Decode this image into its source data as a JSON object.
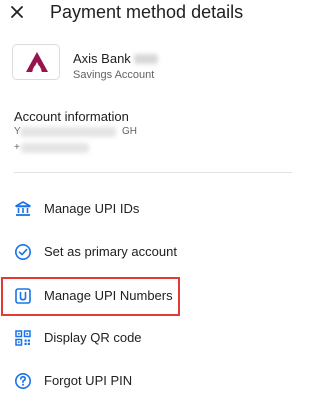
{
  "header": {
    "title": "Payment method details",
    "close_icon": "close-icon"
  },
  "bank": {
    "name": "Axis Bank",
    "name_masked_suffix": "(blurred)",
    "account_type": "Savings Account",
    "brand_color": "#97144d",
    "logo_icon": "axis-bank-logo"
  },
  "account_info": {
    "heading": "Account information",
    "line1_prefix": "Y",
    "line1_suffix": "GH",
    "line2_prefix": "+"
  },
  "menu": {
    "items": [
      {
        "label": "Manage UPI IDs",
        "icon": "bank-icon"
      },
      {
        "label": "Set as primary account",
        "icon": "check-circle-icon"
      },
      {
        "label": "Manage UPI Numbers",
        "icon": "upi-number-icon"
      },
      {
        "label": "Display QR code",
        "icon": "qr-code-icon"
      },
      {
        "label": "Forgot UPI PIN",
        "icon": "help-circle-icon"
      }
    ],
    "icon_color": "#1a73e8",
    "highlighted_item": "Manage UPI Numbers",
    "highlight_color": "#e53935"
  }
}
